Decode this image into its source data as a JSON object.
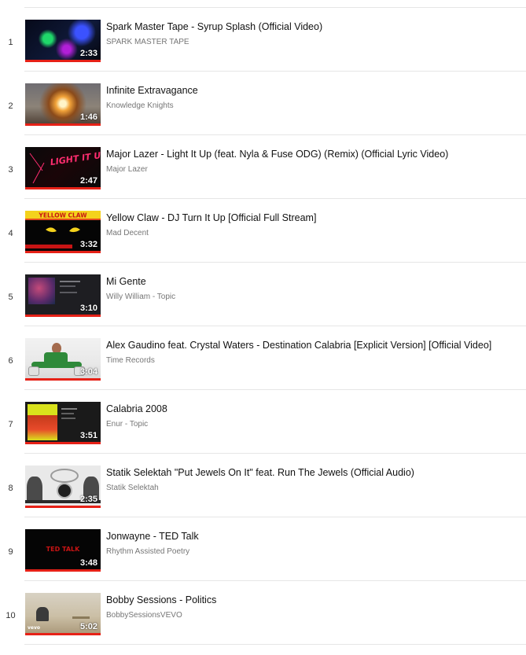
{
  "colors": {
    "progress": "#e62117",
    "title": "#111111",
    "channel": "#767676",
    "divider": "#e6e6e6"
  },
  "videos": [
    {
      "index": "1",
      "title": "Spark Master Tape - Syrup Splash (Official Video)",
      "channel": "SPARK MASTER TAPE",
      "duration": "2:33"
    },
    {
      "index": "2",
      "title": "Infinite Extravagance",
      "channel": "Knowledge Knights",
      "duration": "1:46"
    },
    {
      "index": "3",
      "title": "Major Lazer - Light It Up (feat. Nyla & Fuse ODG) (Remix) (Official Lyric Video)",
      "channel": "Major Lazer",
      "duration": "2:47",
      "thumb_text": "LIGHT IT UP"
    },
    {
      "index": "4",
      "title": "Yellow Claw - DJ Turn It Up [Official Full Stream]",
      "channel": "Mad Decent",
      "duration": "3:32",
      "thumb_text": "YELLOW CLAW"
    },
    {
      "index": "5",
      "title": "Mi Gente",
      "channel": "Willy William - Topic",
      "duration": "3:10"
    },
    {
      "index": "6",
      "title": "Alex Gaudino feat. Crystal Waters - Destination Calabria [Explicit Version] [Official Video]",
      "channel": "Time Records",
      "duration": "3:04"
    },
    {
      "index": "7",
      "title": "Calabria 2008",
      "channel": "Enur - Topic",
      "duration": "3:51"
    },
    {
      "index": "8",
      "title": "Statik Selektah \"Put Jewels On It\" feat. Run The Jewels (Official Audio)",
      "channel": "Statik Selektah",
      "duration": "2:35"
    },
    {
      "index": "9",
      "title": "Jonwayne - TED Talk",
      "channel": "Rhythm Assisted Poetry",
      "duration": "3:48",
      "thumb_text": "TED TALK"
    },
    {
      "index": "10",
      "title": "Bobby Sessions - Politics",
      "channel": "BobbySessionsVEVO",
      "duration": "5:02",
      "thumb_text": "vevo"
    }
  ]
}
